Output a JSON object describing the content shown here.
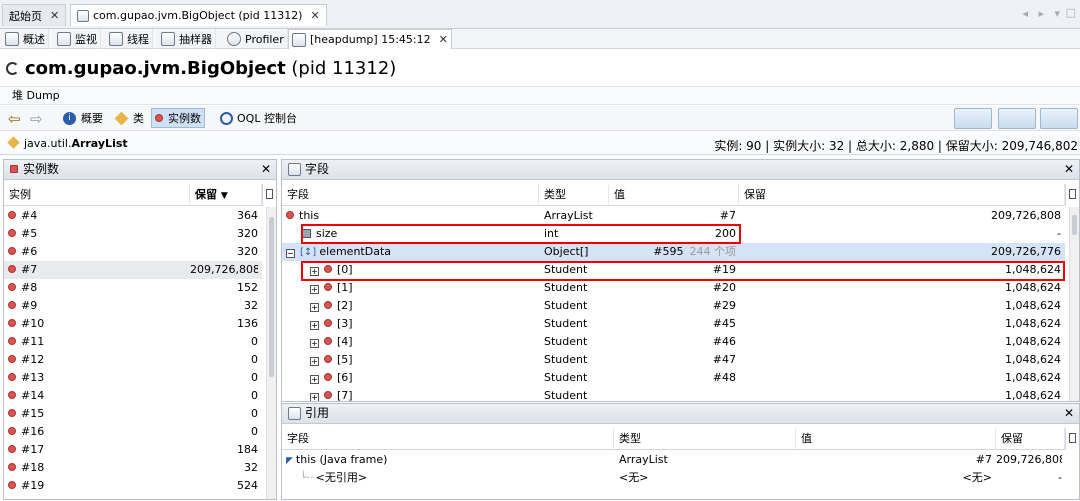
{
  "tabs": [
    {
      "label": "起始页"
    },
    {
      "label": "com.gupao.jvm.BigObject (pid 11312)"
    }
  ],
  "toolbar": {
    "items": [
      "概述",
      "监视",
      "线程",
      "抽样器",
      "Profiler",
      "[heapdump] 15:45:12"
    ]
  },
  "title": {
    "bold": "com.gupao.jvm.BigObject",
    "rest": " (pid 11312)"
  },
  "subtitle": "堆 Dump",
  "nav": {
    "summary": "概要",
    "classes": "类",
    "instances": "实例数",
    "oql": "OQL 控制台"
  },
  "breadcrumb": {
    "pkg": "java.util.",
    "cls": "ArrayList",
    "stats": "实例: 90 | 实例大小: 32 | 总大小: 2,880 | 保留大小: 209,746,802"
  },
  "instances_panel": {
    "title": "实例数",
    "col_instance": "实例",
    "col_retained": "保留",
    "sort_icon": "▼",
    "rows": [
      {
        "name": "#4",
        "value": "364"
      },
      {
        "name": "#5",
        "value": "320"
      },
      {
        "name": "#6",
        "value": "320"
      },
      {
        "name": "#7",
        "value": "209,726,808"
      },
      {
        "name": "#8",
        "value": "152"
      },
      {
        "name": "#9",
        "value": "32"
      },
      {
        "name": "#10",
        "value": "136"
      },
      {
        "name": "#11",
        "value": "0"
      },
      {
        "name": "#12",
        "value": "0"
      },
      {
        "name": "#13",
        "value": "0"
      },
      {
        "name": "#14",
        "value": "0"
      },
      {
        "name": "#15",
        "value": "0"
      },
      {
        "name": "#16",
        "value": "0"
      },
      {
        "name": "#17",
        "value": "184"
      },
      {
        "name": "#18",
        "value": "32"
      },
      {
        "name": "#19",
        "value": "524"
      }
    ]
  },
  "fields_panel": {
    "title": "字段",
    "cols": [
      "字段",
      "类型",
      "值",
      "保留"
    ],
    "rows": [
      {
        "name": "this",
        "type": "ArrayList",
        "value": "#7",
        "extra": "",
        "retained": "209,726,808"
      },
      {
        "name": "size",
        "type": "int",
        "value": "200",
        "extra": "",
        "retained": "-"
      },
      {
        "name": "elementData",
        "type": "Object[]",
        "value": "#595",
        "extra": "244 个项",
        "retained": "209,726,776"
      },
      {
        "name": "[0]",
        "type": "Student",
        "value": "#19",
        "extra": "",
        "retained": "1,048,624"
      },
      {
        "name": "[1]",
        "type": "Student",
        "value": "#20",
        "extra": "",
        "retained": "1,048,624"
      },
      {
        "name": "[2]",
        "type": "Student",
        "value": "#29",
        "extra": "",
        "retained": "1,048,624"
      },
      {
        "name": "[3]",
        "type": "Student",
        "value": "#45",
        "extra": "",
        "retained": "1,048,624"
      },
      {
        "name": "[4]",
        "type": "Student",
        "value": "#46",
        "extra": "",
        "retained": "1,048,624"
      },
      {
        "name": "[5]",
        "type": "Student",
        "value": "#47",
        "extra": "",
        "retained": "1,048,624"
      },
      {
        "name": "[6]",
        "type": "Student",
        "value": "#48",
        "extra": "",
        "retained": "1,048,624"
      },
      {
        "name": "[7]",
        "type": "Student",
        "value": "",
        "extra": "",
        "retained": "1,048,624"
      }
    ]
  },
  "refs_panel": {
    "title": "引用",
    "cols": [
      "字段",
      "类型",
      "值",
      "保留"
    ],
    "rows": [
      {
        "name": "this (Java frame)",
        "type": "ArrayList",
        "value": "#7",
        "retained": "209,726,808"
      },
      {
        "name": "<无引用>",
        "type": "<无>",
        "value": "<无>",
        "retained": "-"
      }
    ]
  },
  "colors": {
    "highlight": "#d5e3f7",
    "redbox": "#ee0000",
    "instance_dot": "#d9534f"
  }
}
